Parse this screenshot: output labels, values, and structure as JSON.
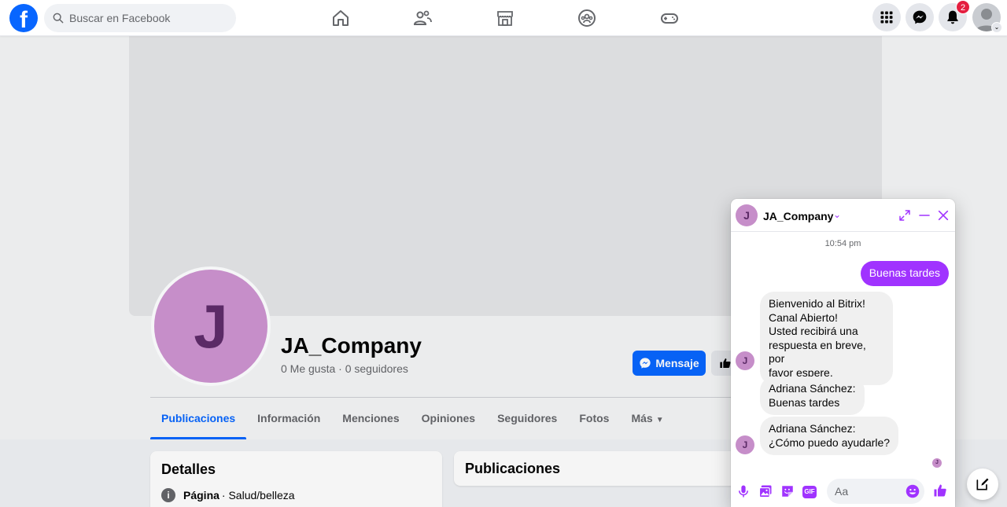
{
  "topbar": {
    "logo": "f",
    "search_placeholder": "Buscar en Facebook",
    "notifications_count": "2"
  },
  "page": {
    "initial": "J",
    "name": "JA_Company",
    "stats": "0 Me gusta · 0 seguidores",
    "message_button": "Mensaje"
  },
  "tabs": [
    {
      "label": "Publicaciones"
    },
    {
      "label": "Información"
    },
    {
      "label": "Menciones"
    },
    {
      "label": "Opiniones"
    },
    {
      "label": "Seguidores"
    },
    {
      "label": "Fotos"
    },
    {
      "label": "Más"
    }
  ],
  "details": {
    "title": "Detalles",
    "type_label": "Página",
    "category": " · Salud/belleza"
  },
  "posts": {
    "title": "Publicaciones"
  },
  "chat": {
    "initial": "J",
    "name": "JA_Company",
    "time": "10:54 pm",
    "messages": [
      {
        "direction": "out",
        "text": "Buenas tardes"
      },
      {
        "direction": "in",
        "text": "Bienvenido al Bitrix!\nCanal Abierto!\nUsted recibirá una\nrespuesta en breve, por\nfavor espere."
      },
      {
        "direction": "in",
        "text": "Adriana Sánchez:\nBuenas tardes"
      },
      {
        "direction": "in",
        "text": "Adriana Sánchez:\n¿Cómo puedo ayudarle?"
      }
    ],
    "input_placeholder": "Aa",
    "gif_label": "GIF"
  },
  "colors": {
    "facebook_blue": "#0866ff",
    "chat_accent": "#a033ff",
    "avatar_bg": "#c68ec9"
  }
}
